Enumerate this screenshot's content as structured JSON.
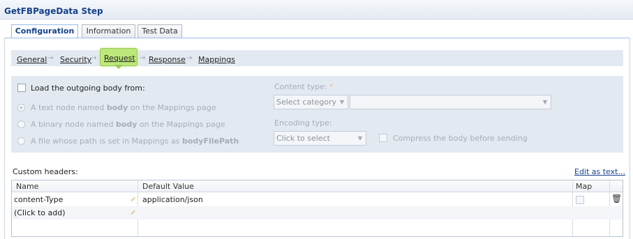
{
  "window": {
    "title": "GetFBPageData Step"
  },
  "tabs": [
    {
      "label": "Configuration",
      "active": true
    },
    {
      "label": "Information",
      "active": false
    },
    {
      "label": "Test Data",
      "active": false
    }
  ],
  "breadcrumb": {
    "items": [
      "General",
      "Security",
      "Request",
      "Response",
      "Mappings"
    ],
    "active": "Request",
    "separator": "→",
    "active_color": "#bce77a"
  },
  "request": {
    "load_body_label": "Load the outgoing body from:",
    "load_body_checked": false,
    "radio_options": [
      {
        "prefix": "A text node named ",
        "bold": "body",
        "suffix": " on the Mappings page",
        "checked": true
      },
      {
        "prefix": "A binary node named ",
        "bold": "body",
        "suffix": " on the Mappings page",
        "checked": false
      },
      {
        "prefix": "A file whose path is set in Mappings as ",
        "bold": "bodyFilePath",
        "suffix": "",
        "checked": false
      }
    ],
    "content_type_label": "Content type:",
    "required_mark": "*",
    "category_value": "Select category",
    "type_value": "",
    "encoding_type_label": "Encoding type:",
    "encoding_value": "Click to select",
    "compress_label": "Compress the body before sending",
    "compress_checked": false
  },
  "custom_headers": {
    "label": "Custom headers:",
    "edit_link": "Edit as text...",
    "columns": [
      "Name",
      "Default Value",
      "Map"
    ],
    "rows": [
      {
        "name": "content-Type",
        "value": "application/json",
        "map": false
      },
      {
        "name": "(Click to add)",
        "value": ""
      }
    ]
  },
  "icons": {
    "arrow": "chevron-down-icon",
    "delete": "trash-icon",
    "edit": "pencil-icon"
  }
}
